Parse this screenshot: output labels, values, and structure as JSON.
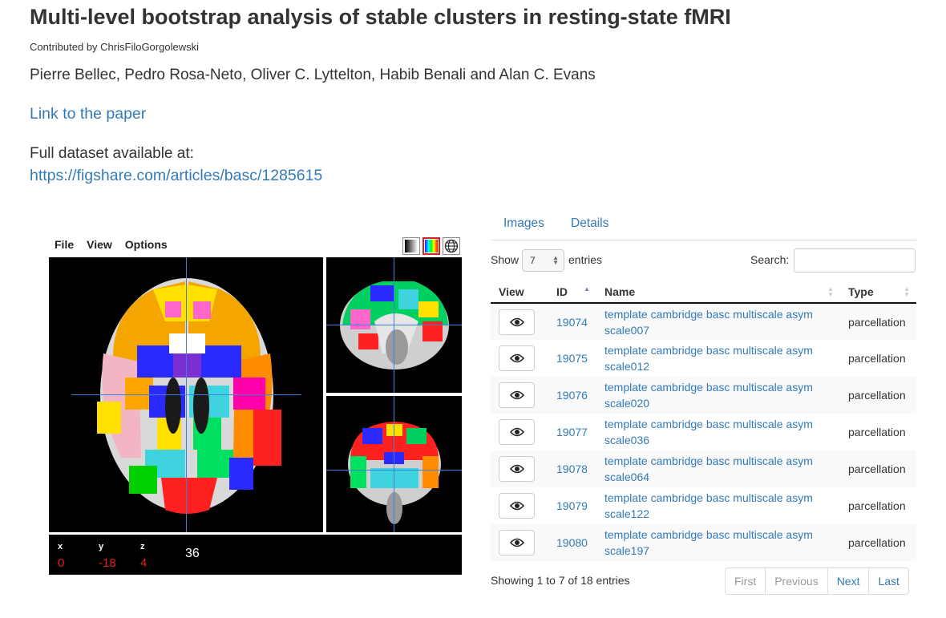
{
  "header": {
    "title": "Multi-level bootstrap analysis of stable clusters in resting-state fMRI",
    "contributor": "Contributed by ChrisFiloGorgolewski",
    "authors": "Pierre Bellec, Pedro Rosa-Neto, Oliver C. Lyttelton, Habib Benali and Alan C. Evans",
    "paper_link": "Link to the paper",
    "dataset_label": "Full dataset available at:",
    "dataset_url": "https://figshare.com/articles/basc/1285615"
  },
  "viewer": {
    "menu": [
      "File",
      "View",
      "Options"
    ],
    "tools": [
      "grayscale-icon",
      "colormap-icon",
      "globe-icon"
    ],
    "coords": {
      "x_label": "x",
      "y_label": "y",
      "z_label": "z",
      "x": "0",
      "y": "-18",
      "z": "4"
    },
    "value": "36",
    "crosshair_color": "#3f7fd6",
    "accent_color": "#e0201e"
  },
  "tabs": [
    "Images",
    "Details"
  ],
  "table_controls": {
    "show_label": "Show",
    "show_value": "7",
    "entries_label": "entries",
    "search_label": "Search:",
    "search_value": ""
  },
  "table": {
    "columns": [
      "View",
      "ID",
      "Name",
      "Type"
    ],
    "rows": [
      {
        "id": "19074",
        "name_line1": "template cambridge basc multiscale asym",
        "name_line2": "scale007",
        "type": "parcellation"
      },
      {
        "id": "19075",
        "name_line1": "template cambridge basc multiscale asym",
        "name_line2": "scale012",
        "type": "parcellation"
      },
      {
        "id": "19076",
        "name_line1": "template cambridge basc multiscale asym",
        "name_line2": "scale020",
        "type": "parcellation"
      },
      {
        "id": "19077",
        "name_line1": "template cambridge basc multiscale asym",
        "name_line2": "scale036",
        "type": "parcellation"
      },
      {
        "id": "19078",
        "name_line1": "template cambridge basc multiscale asym",
        "name_line2": "scale064",
        "type": "parcellation"
      },
      {
        "id": "19079",
        "name_line1": "template cambridge basc multiscale asym",
        "name_line2": "scale122",
        "type": "parcellation"
      },
      {
        "id": "19080",
        "name_line1": "template cambridge basc multiscale asym",
        "name_line2": "scale197",
        "type": "parcellation"
      }
    ]
  },
  "footer": {
    "showing": "Showing 1 to 7 of 18 entries",
    "pager": {
      "first": "First",
      "previous": "Previous",
      "next": "Next",
      "last": "Last"
    }
  }
}
